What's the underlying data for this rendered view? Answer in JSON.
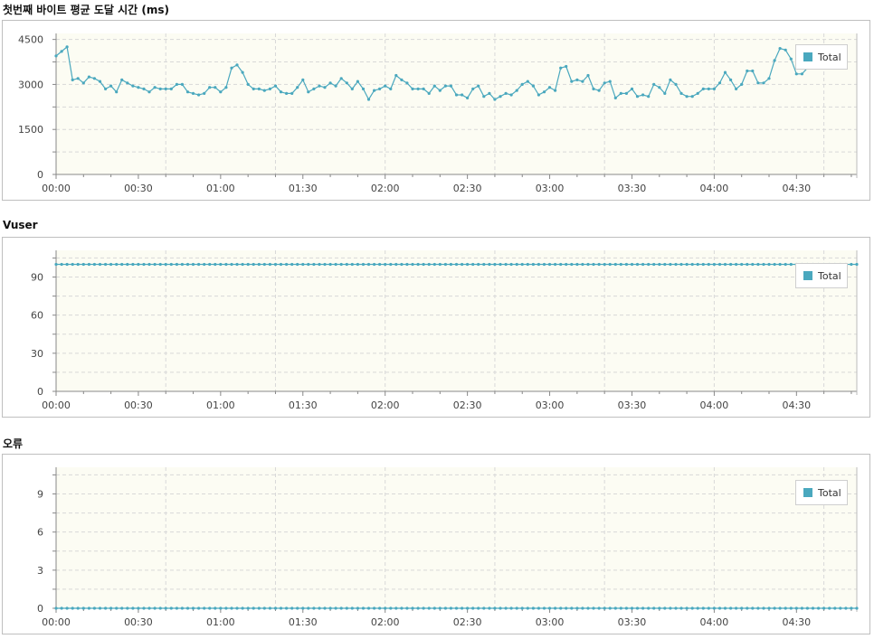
{
  "colors": {
    "series": "#4aa8be",
    "plot_bg": "#fcfcf3",
    "grid": "#d8d8d8",
    "axis": "#888888"
  },
  "chart_data": [
    {
      "type": "line",
      "title": "첫번째 바이트 평균 도달 시간 (ms)",
      "xlabel": "",
      "ylabel": "",
      "x_start": "00:00",
      "x_step_seconds": 2,
      "xlim": [
        "00:00",
        "04:52"
      ],
      "x_ticks": [
        "00:00",
        "00:30",
        "01:00",
        "01:30",
        "02:00",
        "02:30",
        "03:00",
        "03:30",
        "04:00",
        "04:30"
      ],
      "y_ticks": [
        0,
        1500,
        3000,
        4500
      ],
      "ylim": [
        0,
        4700
      ],
      "grid": true,
      "legend": "top-right",
      "series": [
        {
          "name": "Total",
          "values": [
            3950,
            4100,
            4250,
            3150,
            3200,
            3050,
            3250,
            3200,
            3100,
            2850,
            2950,
            2750,
            3150,
            3050,
            2950,
            2900,
            2850,
            2750,
            2900,
            2850,
            2850,
            2850,
            3000,
            3000,
            2750,
            2700,
            2650,
            2700,
            2900,
            2900,
            2750,
            2900,
            3550,
            3650,
            3400,
            3000,
            2850,
            2850,
            2800,
            2850,
            2950,
            2750,
            2700,
            2700,
            2900,
            3150,
            2750,
            2850,
            2950,
            2900,
            3050,
            2950,
            3200,
            3050,
            2850,
            3100,
            2850,
            2500,
            2800,
            2850,
            2950,
            2850,
            3300,
            3150,
            3050,
            2850,
            2850,
            2850,
            2700,
            2950,
            2800,
            2950,
            2950,
            2650,
            2650,
            2550,
            2850,
            2950,
            2600,
            2700,
            2500,
            2600,
            2700,
            2650,
            2800,
            3000,
            3100,
            2950,
            2650,
            2750,
            2900,
            2800,
            3550,
            3600,
            3100,
            3150,
            3100,
            3300,
            2850,
            2800,
            3050,
            3100,
            2550,
            2700,
            2700,
            2850,
            2600,
            2650,
            2600,
            3000,
            2900,
            2700,
            3150,
            3000,
            2700,
            2600,
            2600,
            2700,
            2850,
            2850,
            2850,
            3050,
            3400,
            3150,
            2850,
            3000,
            3450,
            3450,
            3050,
            3050,
            3200,
            3800,
            4200,
            4150,
            3850,
            3350,
            3350,
            3550,
            3750,
            3850,
            3750,
            3600,
            3550,
            4150,
            4150
          ]
        }
      ]
    },
    {
      "type": "line",
      "title": "Vuser",
      "xlabel": "",
      "ylabel": "",
      "x_start": "00:00",
      "x_step_seconds": 2,
      "xlim": [
        "00:00",
        "04:52"
      ],
      "x_ticks": [
        "00:00",
        "00:30",
        "01:00",
        "01:30",
        "02:00",
        "02:30",
        "03:00",
        "03:30",
        "04:00",
        "04:30"
      ],
      "y_ticks": [
        0,
        30,
        60,
        90
      ],
      "ylim": [
        0,
        111
      ],
      "grid": true,
      "legend": "top-right",
      "series": [
        {
          "name": "Total",
          "constant_value": 100,
          "count": 147
        }
      ]
    },
    {
      "type": "line",
      "title": "오류",
      "xlabel": "",
      "ylabel": "",
      "x_start": "00:00",
      "x_step_seconds": 2,
      "xlim": [
        "00:00",
        "04:52"
      ],
      "x_ticks": [
        "00:00",
        "00:30",
        "01:00",
        "01:30",
        "02:00",
        "02:30",
        "03:00",
        "03:30",
        "04:00",
        "04:30"
      ],
      "y_ticks": [
        0,
        3,
        6,
        9
      ],
      "ylim": [
        0,
        11.1
      ],
      "grid": true,
      "legend": "top-right",
      "series": [
        {
          "name": "Total",
          "constant_value": 0,
          "count": 147
        }
      ]
    }
  ]
}
